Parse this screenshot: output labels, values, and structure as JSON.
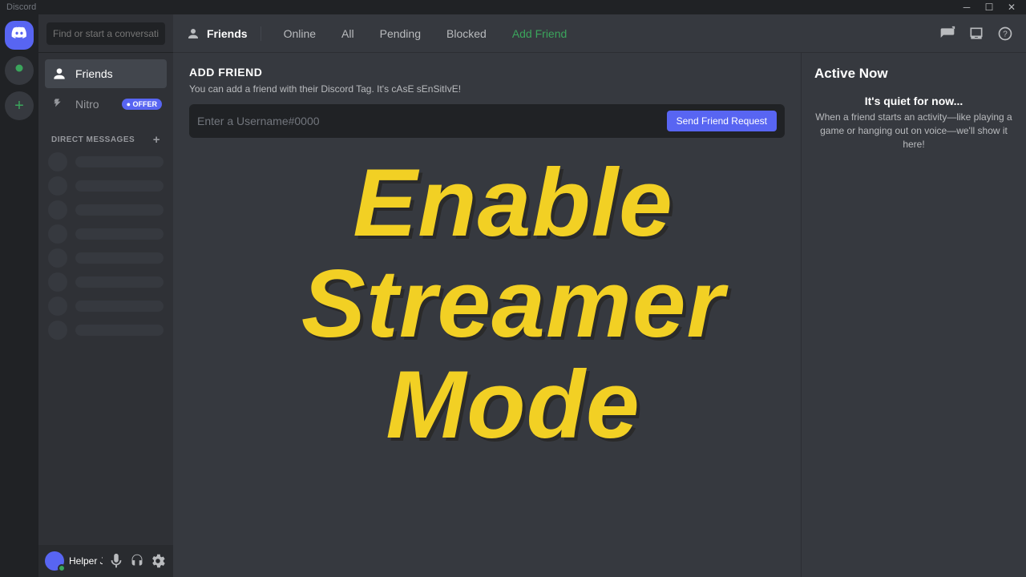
{
  "titlebar": {
    "app_name": "Discord"
  },
  "sidebar": {
    "search_placeholder": "Find or start a conversation",
    "nav": {
      "friends": "Friends",
      "nitro": "Nitro",
      "offer_badge": "● OFFER"
    },
    "dm_header": "DIRECT MESSAGES"
  },
  "user": {
    "name": "Helper Joel"
  },
  "topbar": {
    "title": "Friends",
    "tabs": {
      "online": "Online",
      "all": "All",
      "pending": "Pending",
      "blocked": "Blocked",
      "add": "Add Friend"
    }
  },
  "add_friend": {
    "heading": "ADD FRIEND",
    "description": "You can add a friend with their Discord Tag. It's cAsE sEnSitIvE!",
    "placeholder": "Enter a Username#0000",
    "button": "Send Friend Request"
  },
  "active_now": {
    "title": "Active Now",
    "quiet": "It's quiet for now...",
    "desc": "When a friend starts an activity—like playing a game or hanging out on voice—we'll show it here!"
  },
  "overlay": {
    "line1": "Enable",
    "line2": "Streamer",
    "line3": "Mode"
  }
}
